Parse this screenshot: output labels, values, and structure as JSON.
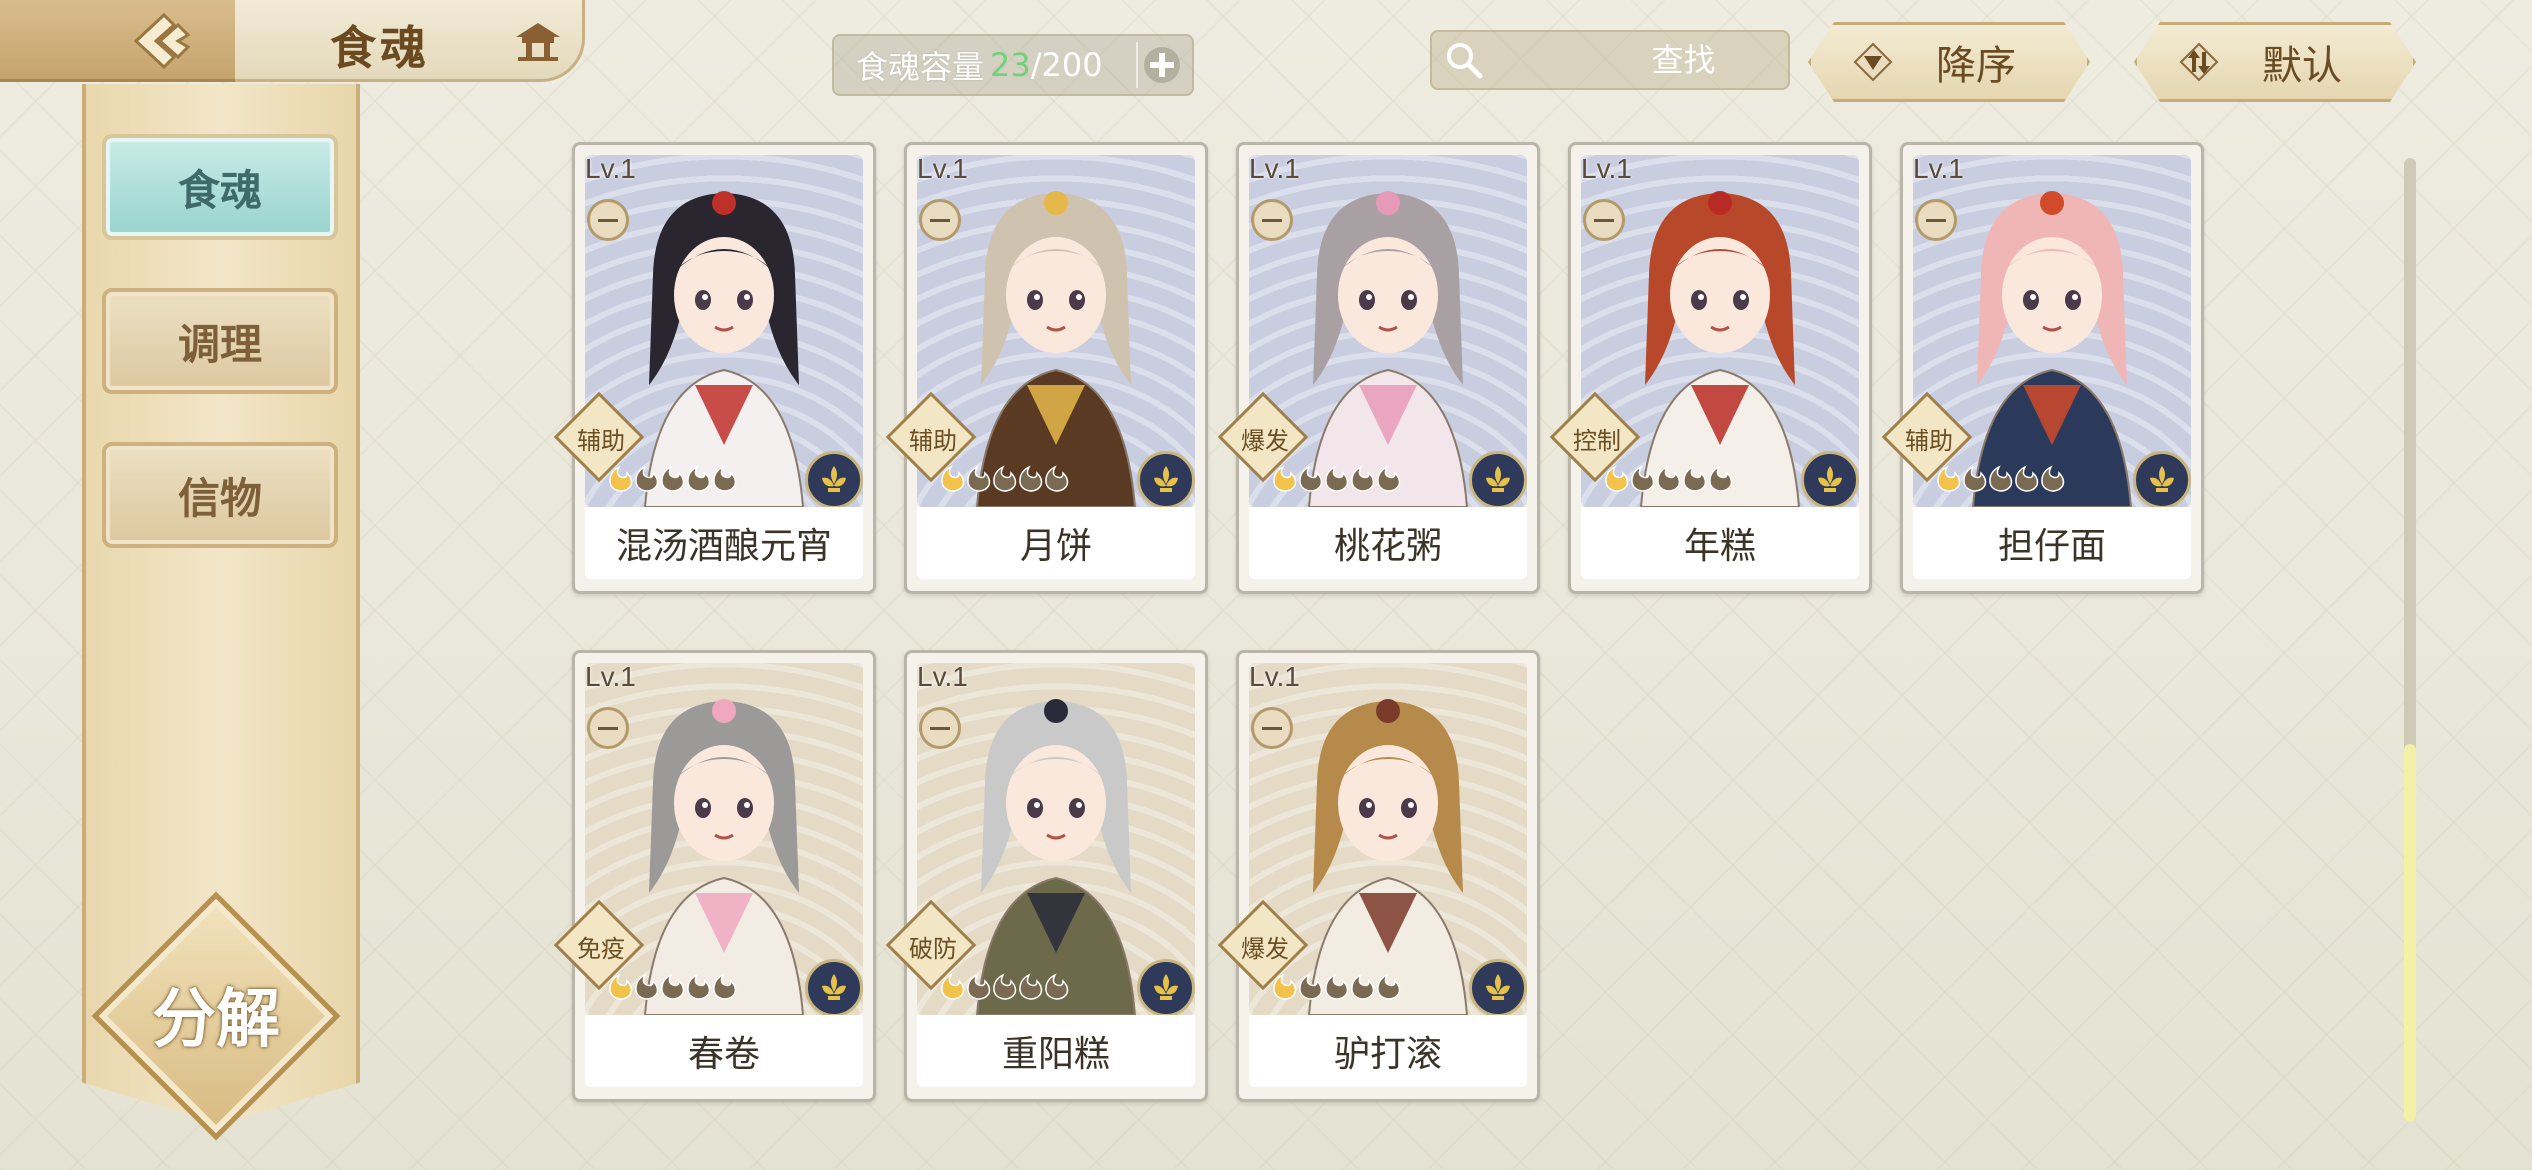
{
  "header": {
    "title": "食魂"
  },
  "capacity": {
    "label": "食魂容量",
    "current": "23",
    "separator": "/",
    "max": "200"
  },
  "search": {
    "placeholder": "查找"
  },
  "sort_button": {
    "label": "降序"
  },
  "default_button": {
    "label": "默认"
  },
  "sidebar": {
    "tabs": [
      {
        "label": "食魂",
        "active": true
      },
      {
        "label": "调理",
        "active": false
      },
      {
        "label": "信物",
        "active": false
      }
    ],
    "decompose_label": "分解"
  },
  "cards": [
    {
      "level": "Lv.1",
      "role": "辅助",
      "name": "混汤酒酿元宵",
      "theme": "blue",
      "hair": "#2a2630",
      "outfit": "#f4f0f0",
      "accent": "#c0302a"
    },
    {
      "level": "Lv.1",
      "role": "辅助",
      "name": "月饼",
      "theme": "blue",
      "hair": "#cfc3b0",
      "outfit": "#5a3a22",
      "accent": "#e6b84a"
    },
    {
      "level": "Lv.1",
      "role": "爆发",
      "name": "桃花粥",
      "theme": "blue",
      "hair": "#a8a0a2",
      "outfit": "#f3e6ea",
      "accent": "#e79ab8"
    },
    {
      "level": "Lv.1",
      "role": "控制",
      "name": "年糕",
      "theme": "blue",
      "hair": "#b8482a",
      "outfit": "#f4efe8",
      "accent": "#b82a24"
    },
    {
      "level": "Lv.1",
      "role": "辅助",
      "name": "担仔面",
      "theme": "blue",
      "hair": "#f0b6b6",
      "outfit": "#2b3a5a",
      "accent": "#d14a2a"
    },
    {
      "level": "Lv.1",
      "role": "免疫",
      "name": "春卷",
      "theme": "tan",
      "hair": "#9c9a98",
      "outfit": "#f2ece4",
      "accent": "#f0a8c0"
    },
    {
      "level": "Lv.1",
      "role": "破防",
      "name": "重阳糕",
      "theme": "tan",
      "hair": "#c9c9c9",
      "outfit": "#6c6a4a",
      "accent": "#2a2a3a"
    },
    {
      "level": "Lv.1",
      "role": "爆发",
      "name": "驴打滚",
      "theme": "tan",
      "hair": "#b58a4a",
      "outfit": "#f3ece2",
      "accent": "#7a3a2a"
    }
  ],
  "icons": {
    "back": "back-arrow-icon",
    "home": "home-pavilion-icon",
    "add": "plus-icon",
    "search": "magnifier-icon",
    "clear": "close-icon",
    "sort": "triangle-down-icon",
    "default": "swap-arrows-icon",
    "element": "fleur-emblem-icon",
    "star": "flame-star-icon"
  }
}
